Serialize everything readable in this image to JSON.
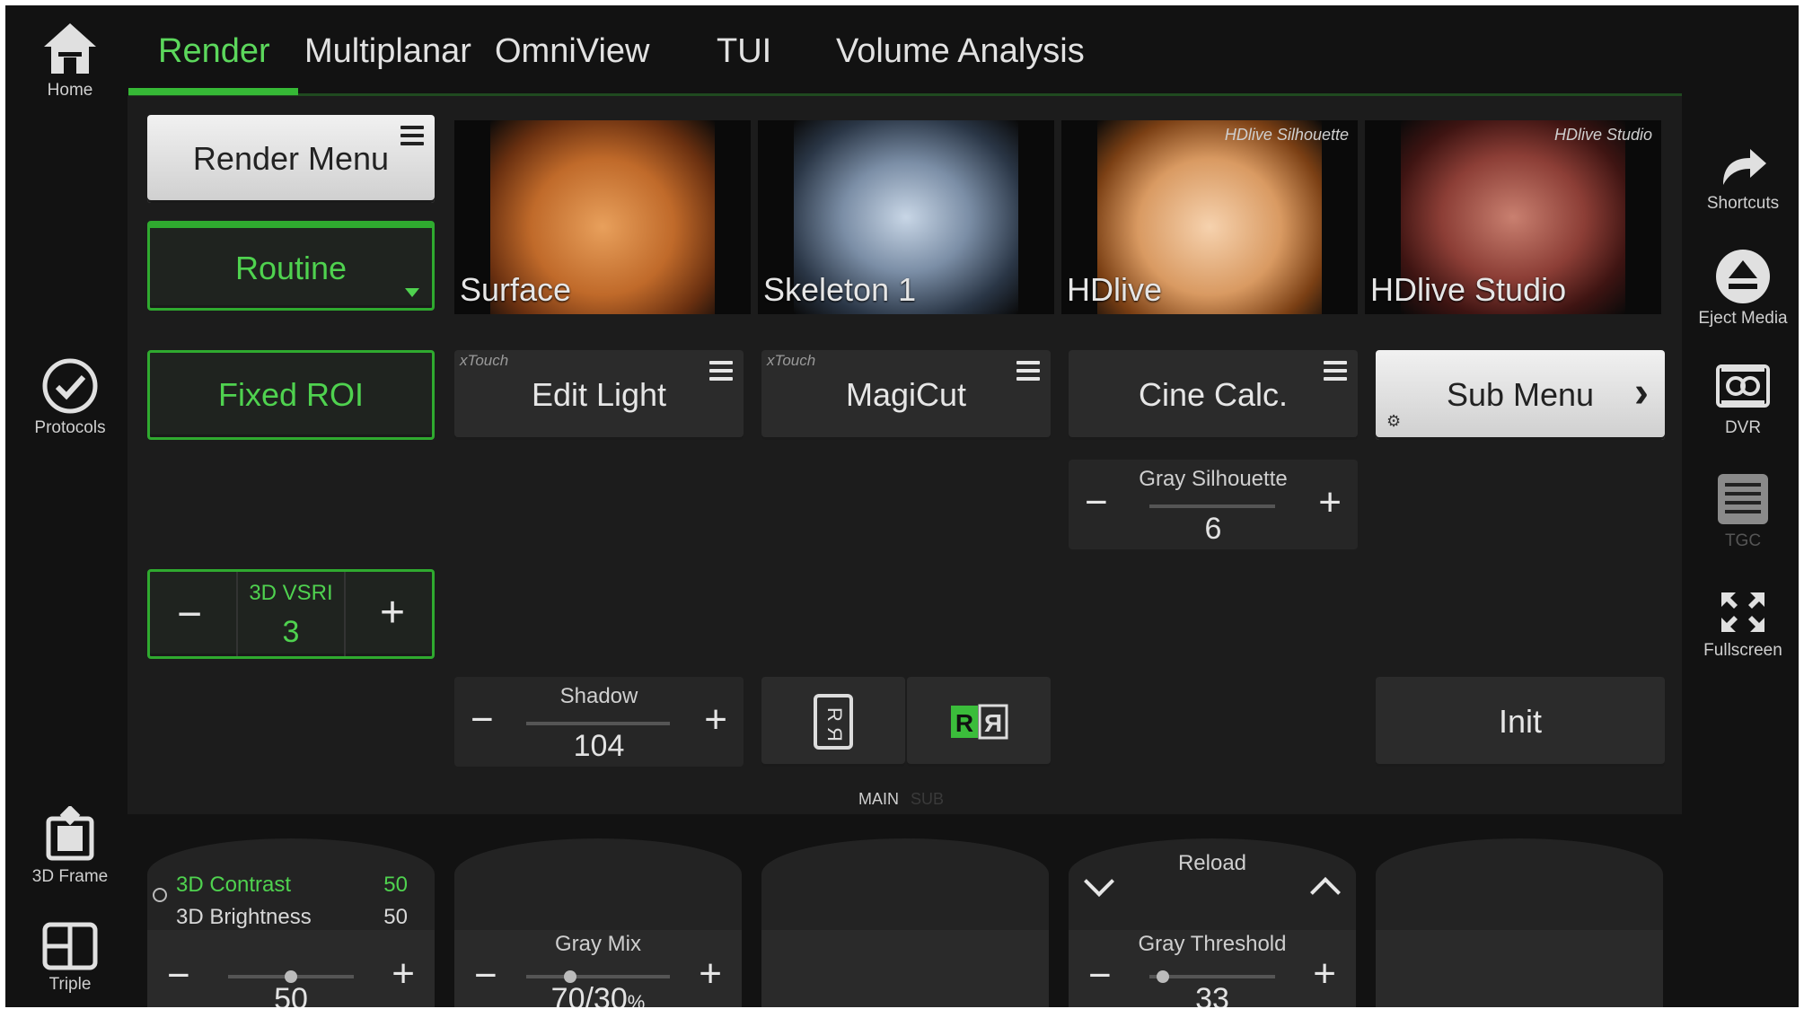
{
  "left_rail": {
    "home": "Home",
    "protocols": "Protocols",
    "frame3d": "3D Frame",
    "triple": "Triple"
  },
  "tabs": [
    "Render",
    "Multiplanar",
    "OmniView",
    "TUI",
    "Volume Analysis"
  ],
  "render_menu": "Render Menu",
  "routine": "Routine",
  "thumbnails": [
    {
      "label": "Surface",
      "tag": ""
    },
    {
      "label": "Skeleton 1",
      "tag": ""
    },
    {
      "label": "HDlive",
      "tag": "HDlive Silhouette"
    },
    {
      "label": "HDlive Studio",
      "tag": "HDlive Studio"
    }
  ],
  "fixed_roi": "Fixed ROI",
  "edit_light": {
    "label": "Edit Light",
    "tag": "xTouch"
  },
  "magicut": {
    "label": "MagiCut",
    "tag": "xTouch"
  },
  "cine_calc": "Cine Calc.",
  "sub_menu": "Sub Menu",
  "gray_silhouette": {
    "label": "Gray Silhouette",
    "value": "6"
  },
  "vsri": {
    "label": "3D VSRI",
    "value": "3"
  },
  "shadow": {
    "label": "Shadow",
    "value": "104"
  },
  "init": "Init",
  "page_indicator": {
    "main": "MAIN",
    "sub": "SUB"
  },
  "dial1": {
    "contrast_label": "3D Contrast",
    "contrast_value": "50",
    "brightness_label": "3D Brightness",
    "brightness_value": "50",
    "value": "50"
  },
  "dial2": {
    "label": "Gray Mix",
    "value": "70/30",
    "unit": "%"
  },
  "dial4": {
    "reload": "Reload",
    "label": "Gray Threshold",
    "value": "33"
  },
  "right_rail": {
    "shortcuts": "Shortcuts",
    "eject": "Eject Media",
    "dvr": "DVR",
    "tgc": "TGC",
    "fullscreen": "Fullscreen"
  },
  "colors": {
    "accent": "#4fd24f",
    "panel": "#1c1c1c",
    "background": "#121212"
  }
}
